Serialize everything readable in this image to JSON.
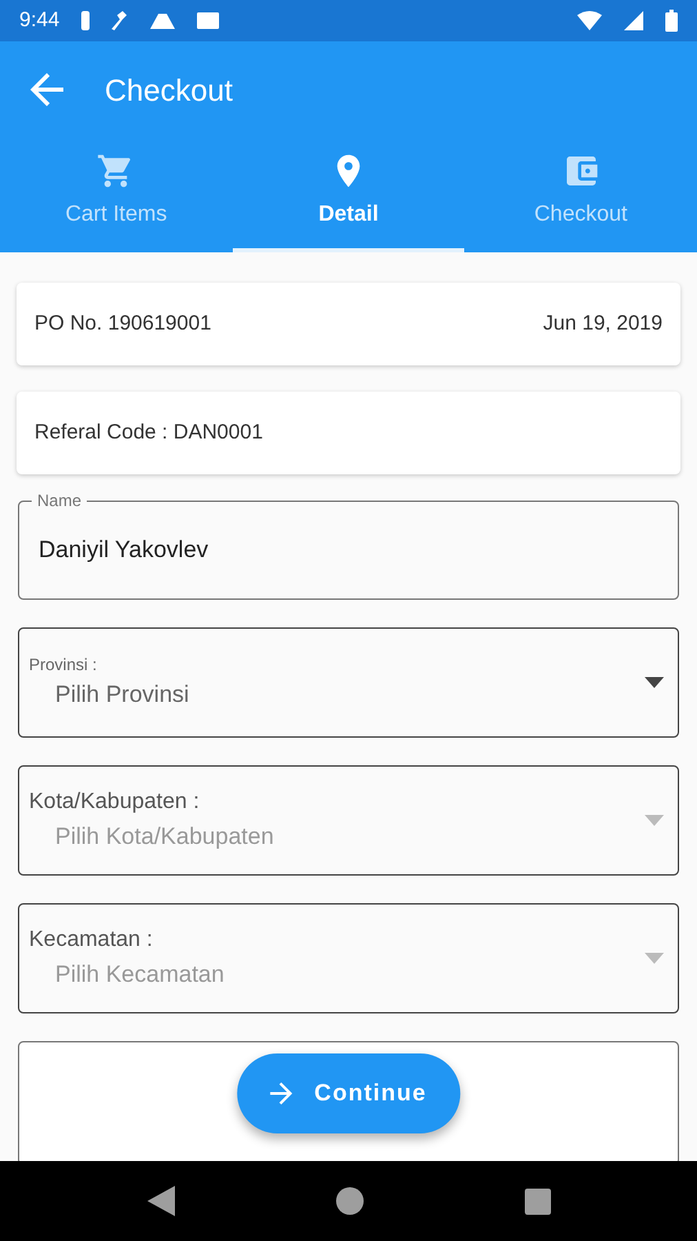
{
  "status_bar": {
    "time": "9:44"
  },
  "app_bar": {
    "title": "Checkout"
  },
  "tabs": [
    {
      "label": "Cart Items",
      "kind": "cart",
      "selected": false
    },
    {
      "label": "Detail",
      "kind": "pin",
      "selected": true
    },
    {
      "label": "Checkout",
      "kind": "wallet",
      "selected": false
    }
  ],
  "order_card": {
    "po_number": "PO No. 190619001",
    "date": "Jun 19, 2019"
  },
  "referral_card": {
    "text": "Referal Code : DAN0001"
  },
  "name_field": {
    "label": "Name",
    "value": "Daniyil Yakovlev"
  },
  "dropdowns": [
    {
      "label": "Provinsi :",
      "placeholder": "Pilih Provinsi",
      "disabled": false
    },
    {
      "label": "Kota/Kabupaten :",
      "placeholder": "Pilih Kota/Kabupaten",
      "disabled": true
    },
    {
      "label": "Kecamatan :",
      "placeholder": "Pilih Kecamatan",
      "disabled": true
    }
  ],
  "continue_button": {
    "label": "Continue"
  }
}
